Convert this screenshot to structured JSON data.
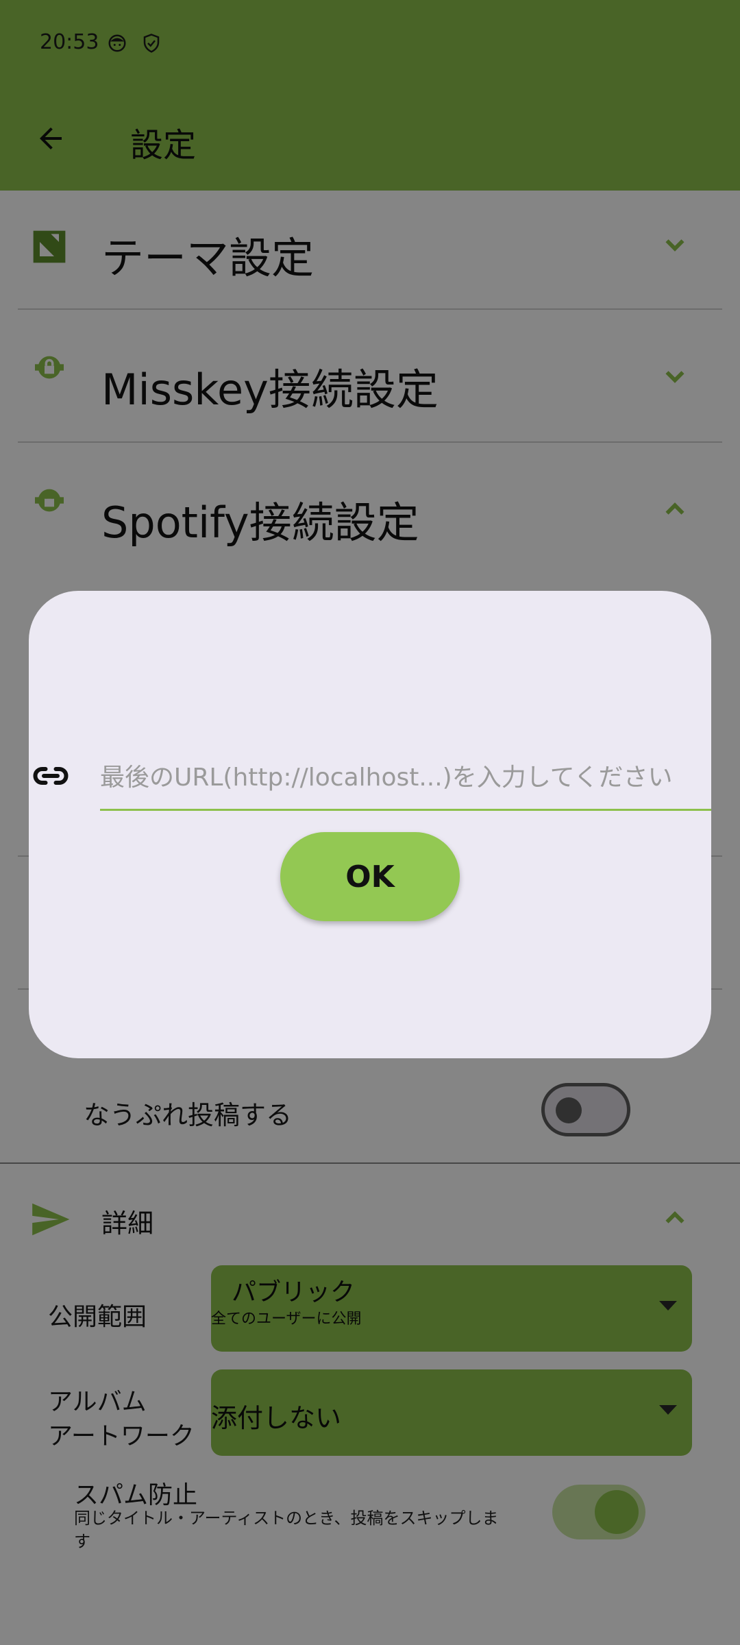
{
  "status_bar": {
    "time": "20:53",
    "icons": [
      "face-icon",
      "shield-check-icon"
    ]
  },
  "app_bar": {
    "title": "設定",
    "back_icon": "arrow-back-icon"
  },
  "sections": [
    {
      "title": "テーマ設定",
      "icon": "palette-icon",
      "expanded": false
    },
    {
      "title": "Misskey接続設定",
      "icon": "lock-icon",
      "expanded": false
    },
    {
      "title": "Spotify接続設定",
      "icon": "lock-icon",
      "expanded": true
    }
  ],
  "nowplaying": {
    "label": "なうぷれ投稿する",
    "enabled": false
  },
  "details": {
    "title": "詳細",
    "icon": "send-icon",
    "expanded": true,
    "visibility": {
      "label": "公開範囲",
      "value": "パブリック",
      "subtext": "全てのユーザーに公開"
    },
    "album_art": {
      "label_line1": "アルバム",
      "label_line2": "アートワーク",
      "value": "添付しない"
    },
    "spam": {
      "label": "スパム防止",
      "description": "同じタイトル・アーティストのとき、投稿をスキップします",
      "enabled": true
    }
  },
  "dialog": {
    "input_placeholder": "最後のURL(http://localhost...)を入力してください",
    "input_value": "",
    "ok_label": "OK"
  },
  "colors": {
    "accent": "#8cc04b",
    "dialog_bg": "#ece9f3",
    "scrim": "rgba(0,0,0,0.48)"
  }
}
